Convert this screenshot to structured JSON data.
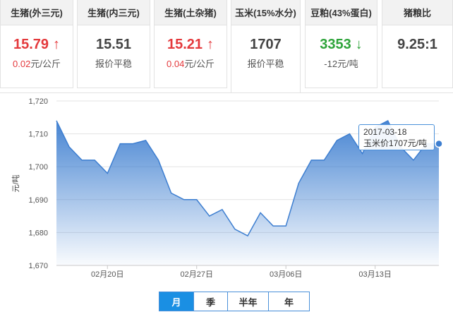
{
  "cards": [
    {
      "title": "生猪(外三元)",
      "price": "15.79",
      "arrow": "↑",
      "trend": "up",
      "sub_num": "0.02",
      "sub_unit": "元/公斤",
      "sub_text": ""
    },
    {
      "title": "生猪(内三元)",
      "price": "15.51",
      "arrow": "",
      "trend": "flat",
      "sub_num": "",
      "sub_unit": "",
      "sub_text": "报价平稳"
    },
    {
      "title": "生猪(土杂猪)",
      "price": "15.21",
      "arrow": "↑",
      "trend": "up",
      "sub_num": "0.04",
      "sub_unit": "元/公斤",
      "sub_text": ""
    },
    {
      "title": "玉米(15%水分)",
      "price": "1707",
      "arrow": "",
      "trend": "flat",
      "sub_num": "",
      "sub_unit": "",
      "sub_text": "报价平稳"
    },
    {
      "title": "豆粕(43%蛋白)",
      "price": "3353",
      "arrow": "↓",
      "trend": "down",
      "sub_num": "",
      "sub_unit": "",
      "sub_text": "-12元/吨"
    },
    {
      "title": "猪粮比",
      "price": "9.25:1",
      "arrow": "",
      "trend": "flat",
      "sub_num": "",
      "sub_unit": "",
      "sub_text": ""
    }
  ],
  "tooltip": {
    "date": "2017-03-18",
    "text": "玉米价1707元/吨"
  },
  "period_tabs": [
    {
      "label": "月",
      "selected": true
    },
    {
      "label": "季",
      "selected": false
    },
    {
      "label": "半年",
      "selected": false
    },
    {
      "label": "年",
      "selected": false
    }
  ],
  "colors": {
    "up": "#e4393c",
    "down": "#2ea43a",
    "accent": "#1a8fe3",
    "line": "#3d7ed0"
  },
  "chart_data": {
    "type": "area",
    "ylabel": "元/吨",
    "ylim": [
      1670,
      1720
    ],
    "yticks": [
      1670,
      1680,
      1690,
      1700,
      1710,
      1720
    ],
    "ytick_labels": [
      "1,670",
      "1,680",
      "1,690",
      "1,700",
      "1,710",
      "1,720"
    ],
    "x_start": "2017-02-16",
    "x_end": "2017-03-18",
    "xticks": [
      "2017-02-20",
      "2017-02-27",
      "2017-03-06",
      "2017-03-13"
    ],
    "xtick_labels": [
      "02月20日",
      "02月27日",
      "03月06日",
      "03月13日"
    ],
    "x": [
      "2017-02-16",
      "2017-02-17",
      "2017-02-18",
      "2017-02-19",
      "2017-02-20",
      "2017-02-21",
      "2017-02-22",
      "2017-02-23",
      "2017-02-24",
      "2017-02-25",
      "2017-02-26",
      "2017-02-27",
      "2017-02-28",
      "2017-03-01",
      "2017-03-02",
      "2017-03-03",
      "2017-03-04",
      "2017-03-05",
      "2017-03-06",
      "2017-03-07",
      "2017-03-08",
      "2017-03-09",
      "2017-03-10",
      "2017-03-11",
      "2017-03-12",
      "2017-03-13",
      "2017-03-14",
      "2017-03-15",
      "2017-03-16",
      "2017-03-17",
      "2017-03-18"
    ],
    "values": [
      1714,
      1706,
      1702,
      1702,
      1698,
      1707,
      1707,
      1708,
      1702,
      1692,
      1690,
      1690,
      1685,
      1687,
      1681,
      1679,
      1686,
      1682,
      1682,
      1695,
      1702,
      1702,
      1708,
      1710,
      1704,
      1712,
      1714,
      1706,
      1702,
      1707,
      1707
    ],
    "highlight_index": 30,
    "grid": true
  }
}
